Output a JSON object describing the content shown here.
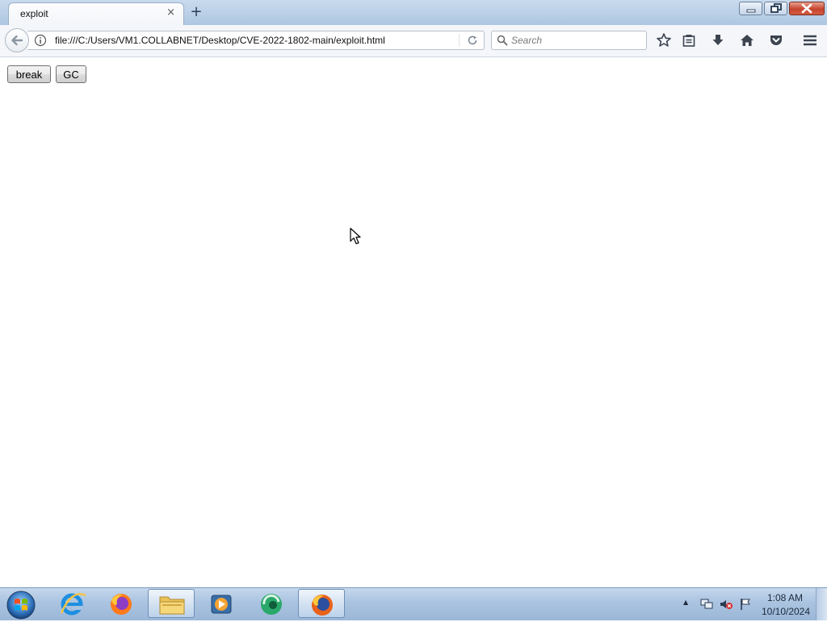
{
  "browser": {
    "tab": {
      "title": "exploit",
      "close_glyph": "×"
    },
    "new_tab_glyph": "+",
    "url": "file:///C:/Users/VM1.COLLABNET/Desktop/CVE-2022-1802-main/exploit.html",
    "search": {
      "placeholder": "Search",
      "value": ""
    },
    "toolbar_icons": [
      "back-arrow-icon",
      "info-icon",
      "reload-icon",
      "search-icon",
      "bookmark-star-icon",
      "reading-list-icon",
      "download-icon",
      "home-icon",
      "pocket-icon",
      "menu-icon"
    ],
    "window_controls": [
      "minimize",
      "restore",
      "close"
    ]
  },
  "page": {
    "buttons": {
      "break": "break",
      "gc": "GC"
    }
  },
  "taskbar": {
    "apps": [
      "start-orb",
      "internet-explorer",
      "firefox",
      "file-explorer",
      "media-player",
      "app-green-circle",
      "firefox-active"
    ],
    "clock": {
      "time": "1:08 AM",
      "date": "10/10/2024"
    },
    "tray_glyph": "▲"
  }
}
